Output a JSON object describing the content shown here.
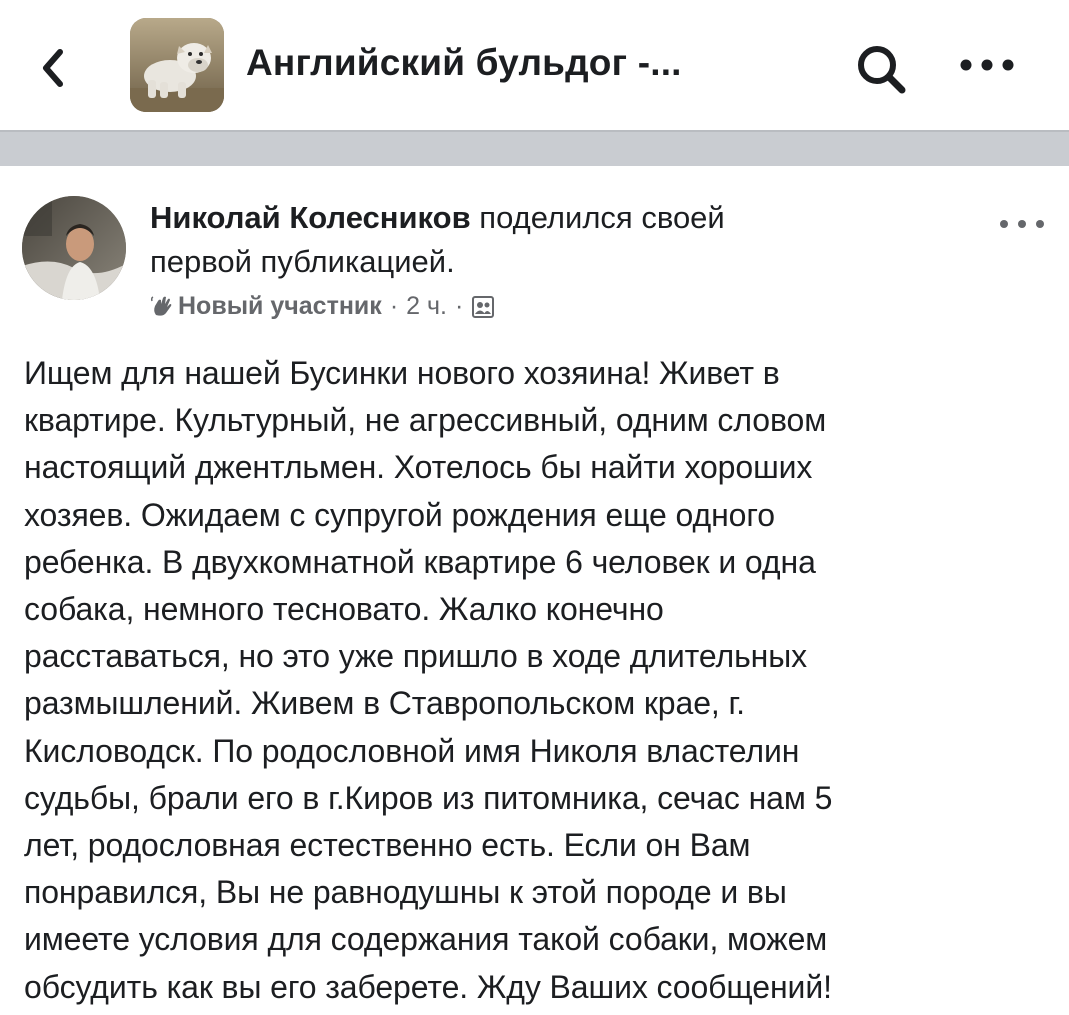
{
  "header": {
    "back_icon": "chevron-left-icon",
    "group_title": "Английский бульдог -...",
    "search_icon": "search-icon",
    "more_icon": "more-horizontal-icon"
  },
  "post": {
    "author_name": "Николай Колесников",
    "action_text": "поделился своей",
    "action_text_2": "первой публикацией.",
    "badge_icon": "waving-hand-icon",
    "badge": "Новый участник",
    "separator": "·",
    "time": "2 ч.",
    "privacy_icon": "group-audience-icon",
    "more_icon": "more-horizontal-icon",
    "body_lines": [
      "Ищем для нашей Бусинки нового хозяина! Живет в",
      "квартире. Культурный, не агрессивный, одним словом",
      "настоящий джентльмен. Хотелось бы найти хороших",
      "хозяев. Ожидаем с супругой рождения еще одного",
      "ребенка. В двухкомнатной квартире 6 человек и одна",
      "собака, немного тесновато. Жалко конечно",
      "расставаться, но это уже пришло в ходе длительных",
      "размышлений. Живем в Ставропольском крае, г.",
      "Кисловодск. По родословной имя Николя властелин",
      "судьбы, брали его в г.Киров из питомника, сечас нам 5",
      "лет, родословная естественно есть. Если он Вам",
      "понравился, Вы не равнодушны к этой породе и вы",
      "имеете условия для содержания такой собаки, можем",
      "обсудить как вы его заберете. Жду Ваших сообщений!"
    ]
  },
  "colors": {
    "text": "#1c1e21",
    "meta": "#65676b",
    "divider": "#c9ccd1"
  }
}
